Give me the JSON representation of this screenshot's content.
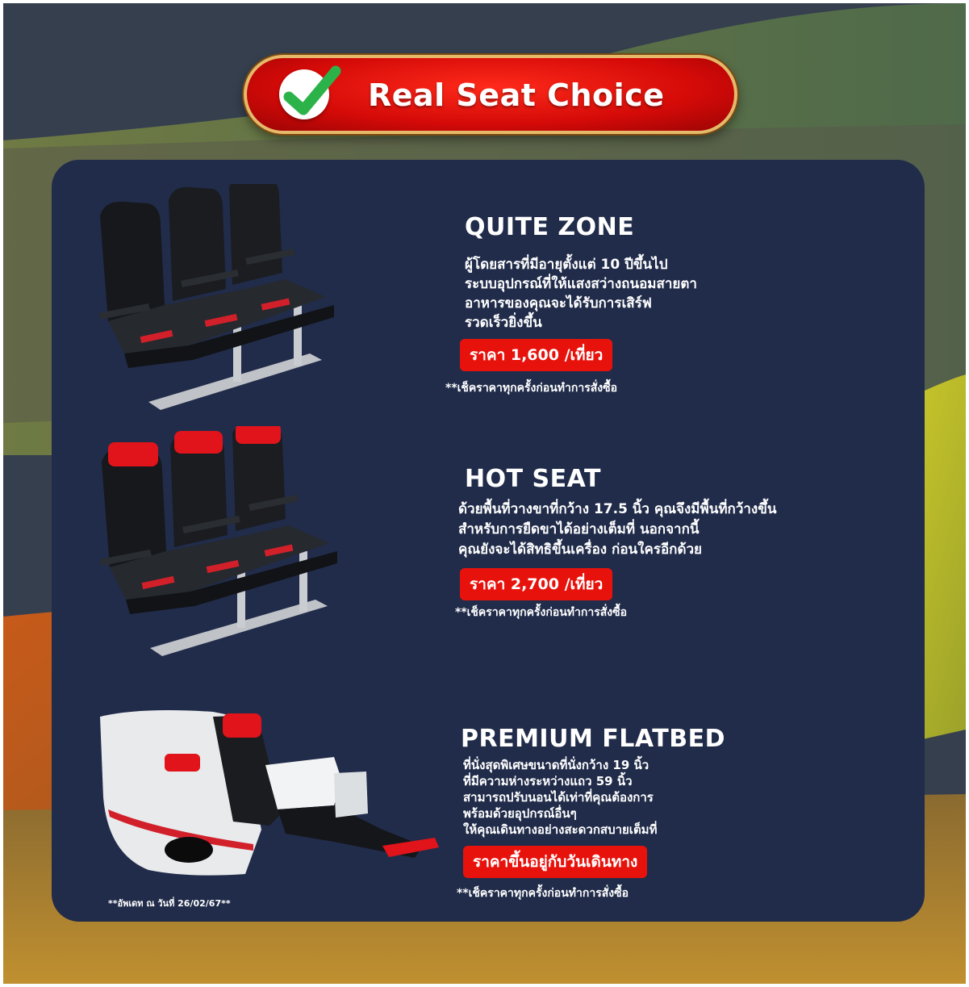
{
  "banner": {
    "icon": "check-icon",
    "title": "Real Seat Choice"
  },
  "colors": {
    "card": "#212c4a",
    "banner_red": "#e8120c",
    "banner_border": "#e6b96a",
    "price_badge": "#e8120c",
    "check_green": "#2bb34a"
  },
  "seats": [
    {
      "image": "economy-seat-black-headrest-image",
      "heading": "QUITE ZONE",
      "lines": [
        "ผู้โดยสารที่มีอายุตั้งแต่ 10 ปีขึ้นไป",
        "ระบบอุปกรณ์ที่ให้แสงสว่างถนอมสายตา",
        "อาหารของคุณจะได้รับการเสิร์ฟ",
        "รวดเร็วยิ่งขึ้น"
      ],
      "price": "ราคา 1,600 /เที่ยว",
      "note": "**เช็คราคาทุกครั้งก่อนทำการสั่งซื้อ"
    },
    {
      "image": "economy-seat-red-headrest-image",
      "heading": "HOT SEAT",
      "lines": [
        "ด้วยพื้นที่วางขาที่กว้าง 17.5 นิ้ว คุณจึงมีพื้นที่กว้างขึ้น",
        "สำหรับการยืดขาได้อย่างเต็มที่ นอกจากนี้",
        "คุณยังจะได้สิทธิขึ้นเครื่อง ก่อนใครอีกด้วย"
      ],
      "price": "ราคา 2,700 /เที่ยว",
      "note": "**เช็คราคาทุกครั้งก่อนทำการสั่งซื้อ"
    },
    {
      "image": "premium-flatbed-seat-image",
      "heading": "PREMIUM FLATBED",
      "lines": [
        "ที่นั่งสุดพิเศษขนาดที่นั่งกว้าง 19 นิ้ว",
        "ที่มีความห่างระหว่างแถว 59 นิ้ว",
        "สามารถปรับนอนได้เท่าที่คุณต้องการ",
        "พร้อมด้วยอุปกรณ์อื่นๆ",
        "ให้คุณเดินทางอย่างสะดวกสบายเต็มที่"
      ],
      "price": "ราคาขึ้นอยู่กับวันเดินทาง",
      "note": "**เช็คราคาทุกครั้งก่อนทำการสั่งซื้อ"
    }
  ],
  "footer": {
    "update_note": "**อัพเดท ณ วันที่ 26/02/67**"
  }
}
